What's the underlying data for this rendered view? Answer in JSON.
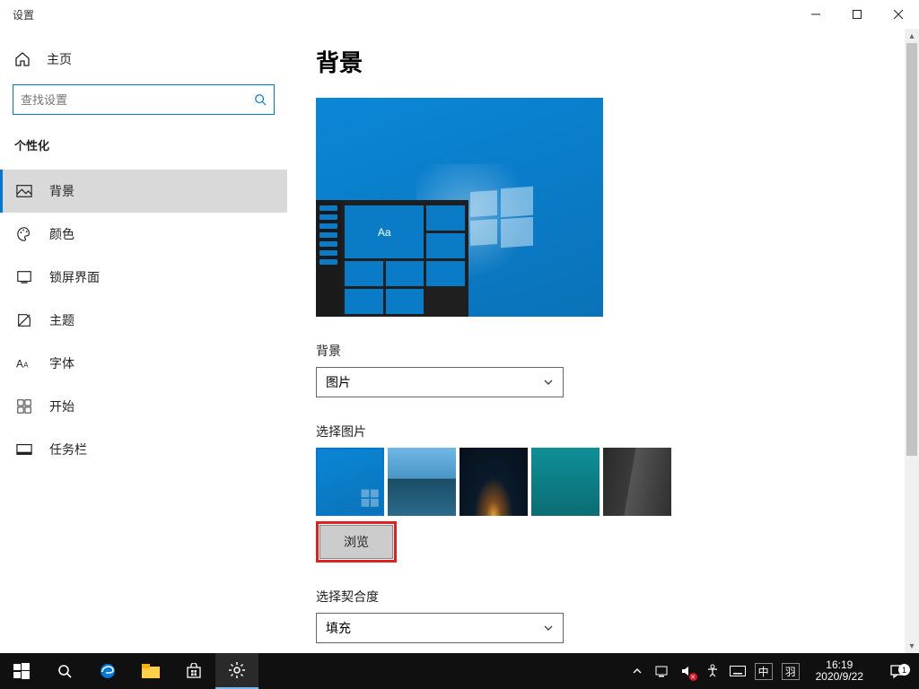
{
  "window": {
    "title": "设置"
  },
  "sidebar": {
    "home": "主页",
    "search_placeholder": "查找设置",
    "section": "个性化",
    "items": [
      {
        "label": "背景"
      },
      {
        "label": "颜色"
      },
      {
        "label": "锁屏界面"
      },
      {
        "label": "主题"
      },
      {
        "label": "字体"
      },
      {
        "label": "开始"
      },
      {
        "label": "任务栏"
      }
    ]
  },
  "content": {
    "heading": "背景",
    "preview_sample_text": "Aa",
    "bg_label": "背景",
    "bg_value": "图片",
    "pick_label": "选择图片",
    "browse": "浏览",
    "fit_label": "选择契合度",
    "fit_value": "填充"
  },
  "taskbar": {
    "ime1": "中",
    "ime2": "羽",
    "time": "16:19",
    "date": "2020/9/22",
    "notif_count": "1"
  }
}
